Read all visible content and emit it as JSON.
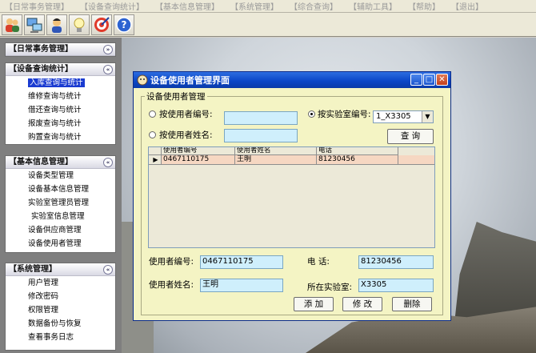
{
  "menubar": {
    "items": [
      "【日常事务管理】",
      "【设备查询统计】",
      "【基本信息管理】",
      "【系统管理】",
      "【综合查询】",
      "【辅助工具】",
      "【帮助】",
      "【退出】"
    ]
  },
  "toolbar": {
    "icons": [
      "users-icon",
      "network-icon",
      "person-icon",
      "lightbulb-icon",
      "target-icon",
      "help-icon"
    ],
    "help_glyph": "?"
  },
  "sidebar": {
    "panels": [
      {
        "title": "【日常事务管理】",
        "toggle": "»",
        "items": []
      },
      {
        "title": "【设备查询统计】",
        "toggle": "«",
        "items": [
          "入库查询与统计",
          "维修查询与统计",
          "借还查询与统计",
          "报废查询与统计",
          "购置查询与统计"
        ]
      },
      {
        "title": "【基本信息管理】",
        "toggle": "«",
        "items": [
          "设备类型管理",
          "设备基本信息管理",
          "实验室管理员管理",
          "实验室信息管理",
          "设备供应商管理",
          "设备使用者管理"
        ]
      },
      {
        "title": "【系统管理】",
        "toggle": "«",
        "items": [
          "用户管理",
          "修改密码",
          "权限管理",
          "数据备份与恢复",
          "查看事务日志"
        ]
      }
    ]
  },
  "dialog": {
    "title": "设备使用者管理界面",
    "group_label": "设备使用者管理",
    "search": {
      "radio_user_id_label": "按使用者编号:",
      "radio_user_name_label": "按使用者姓名:",
      "radio_lab_id_label": "按实验室编号:",
      "user_id_value": "",
      "user_name_value": "",
      "lab_select_value": "1_X3305",
      "query_button": "查 询"
    },
    "grid": {
      "columns": [
        "使用者编号",
        "使用者姓名",
        "电话"
      ],
      "rows": [
        [
          "0467110175",
          "王明",
          "81230456"
        ]
      ],
      "row_marker": "▶"
    },
    "detail": {
      "user_id_label": "使用者编号:",
      "user_id_value": "0467110175",
      "user_name_label": "使用者姓名:",
      "user_name_value": "王明",
      "phone_label": "电      话:",
      "phone_value": "81230456",
      "lab_label": "所在实验室:",
      "lab_value": "X3305"
    },
    "buttons": {
      "add": "添 加",
      "edit": "修 改",
      "delete": "删除"
    }
  }
}
